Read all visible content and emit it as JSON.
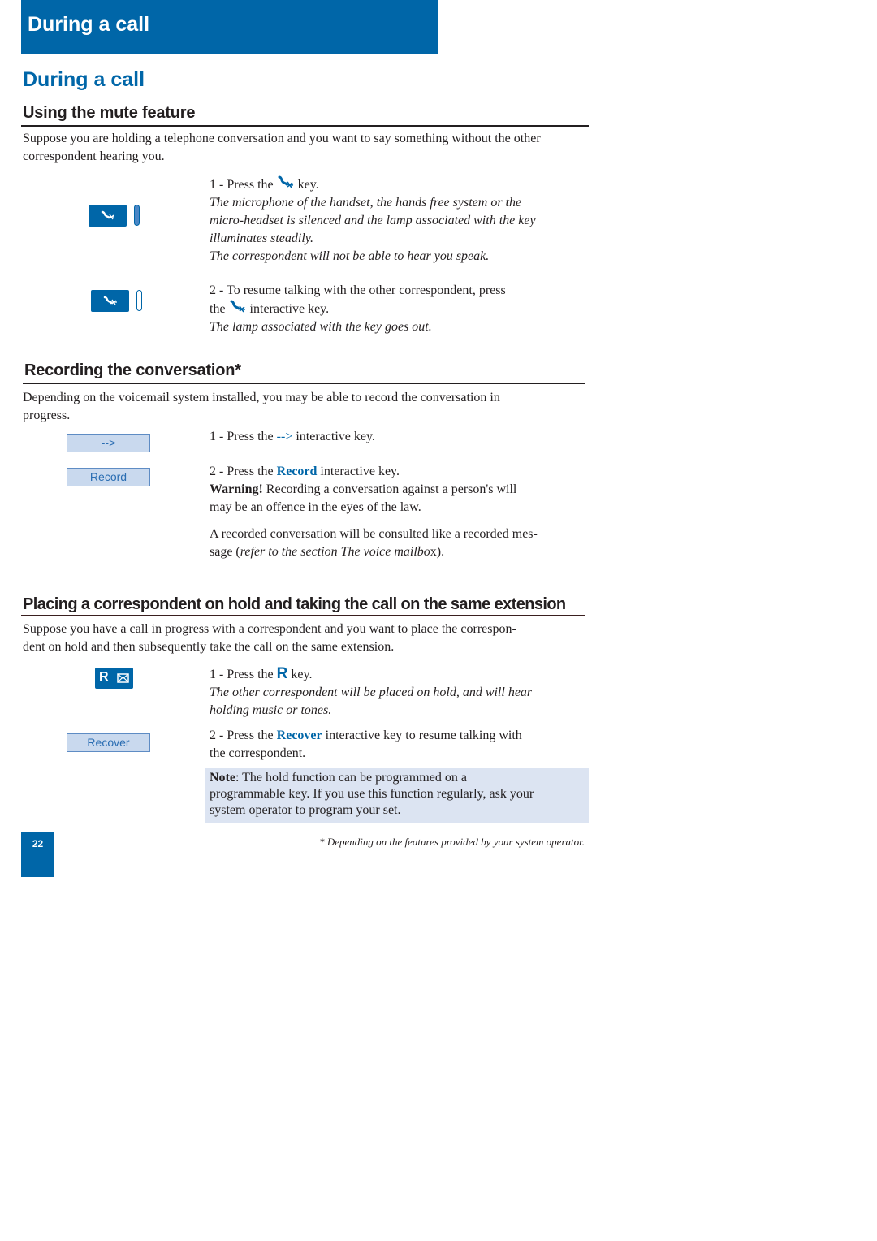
{
  "header": {
    "banner_title": "During a call",
    "page_title": "During a call"
  },
  "colors": {
    "brand_blue": "#0066a8",
    "soft_key_fill": "#c9d9ee",
    "note_fill": "#dce4f2"
  },
  "mute": {
    "heading": "Using the mute feature",
    "intro": "Suppose you are holding a telephone conversation and you want to say something without the other correspondent hearing you.",
    "step1_prefix": "1 - Press the",
    "step1_suffix": "key.",
    "step1_note_lines": [
      "The microphone of the handset, the hands free system or the",
      "micro-headset is silenced and the lamp associated with the key",
      "illuminates steadily.",
      "The correspondent will not be able to hear you speak."
    ],
    "step2_line1": "2 - To resume talking with the other correspondent, press",
    "step2_prefix": "the",
    "step2_suffix": "interactive key.",
    "step2_note": "The lamp associated with the key goes out.",
    "key_icon": "mute-icon",
    "lamp_states": [
      "on",
      "off"
    ]
  },
  "recording": {
    "heading": "Recording the conversation*",
    "intro_lines": [
      "Depending on the voicemail system installed, you may be able to record the conversation in",
      "progress."
    ],
    "soft_keys": [
      "-->",
      "Record"
    ],
    "step1_prefix": "1 - Press the",
    "step1_key": "-->",
    "step1_suffix": "interactive key.",
    "step2_prefix": "2 - Press the",
    "step2_key": "Record",
    "step2_suffix": "interactive key.",
    "warning_label": "Warning!",
    "warning_lines": [
      "Recording a conversation against a person's will",
      "may be an offence in the eyes of the law."
    ],
    "consult_line1": "A recorded conversation will be consulted like a recorded mes-",
    "consult_prefix": "sage (",
    "consult_ref": "refer to the section The voice mailbo",
    "consult_suffix": "x)."
  },
  "hold": {
    "heading": "Placing a correspondent on hold and taking the call on the same extension",
    "intro_lines": [
      "Suppose you have a call in progress with a correspondent and you want to place the correspon-",
      "dent on hold and then subsequently take the call on the same extension."
    ],
    "r_key_letter": "R",
    "step1_prefix": "1 - Press the",
    "step1_key": "R",
    "step1_suffix": "key.",
    "step1_note_lines": [
      "The other correspondent will be placed on hold, and will hear",
      "holding music or tones."
    ],
    "soft_key": "Recover",
    "step2_prefix": "2 - Press the",
    "step2_key": "Recover",
    "step2_suffix": "interactive key to resume talking with",
    "step2_line2": "the correspondent.",
    "note_label": "Note",
    "note_first": ": The hold function can be programmed on a",
    "note_lines": [
      "programmable key. If you use this function regularly, ask your",
      "system operator to program your set."
    ]
  },
  "footer": {
    "footnote": "* Depending on the features provided by your system operator.",
    "page_number": "22"
  }
}
